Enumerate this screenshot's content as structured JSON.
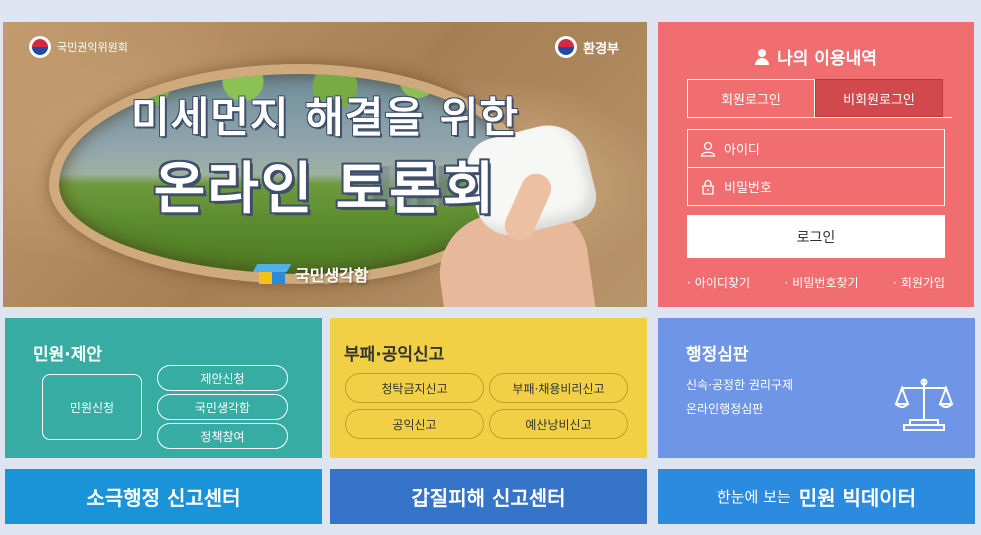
{
  "banner": {
    "org_left": "국민권익위원회",
    "org_right": "환경부",
    "title_line1": "미세먼지 해결을 위한",
    "title_line2": "온라인 토론회",
    "brand": "국민생각함"
  },
  "login": {
    "heading": "나의 이용내역",
    "tab_member": "회원로그인",
    "tab_guest": "비회원로그인",
    "id_placeholder": "아이디",
    "pw_placeholder": "비밀번호",
    "login_button": "로그인",
    "links": [
      "아이디찾기",
      "비밀번호찾기",
      "회원가입"
    ]
  },
  "petition": {
    "title": "민원·제안",
    "main_button": "민원신청",
    "buttons": [
      "제안신청",
      "국민생각함",
      "정책참여"
    ]
  },
  "report": {
    "title": "부패·공익신고",
    "buttons": [
      "청탁금지신고",
      "부패·채용비리신고",
      "공익신고",
      "예산낭비신고"
    ]
  },
  "trial": {
    "title": "행정심판",
    "desc1": "신속·공정한 권리구제",
    "desc2": "온라인행정심판"
  },
  "bars": {
    "passive_admin": "소극행정 신고센터",
    "gapjil": "갑질피해 신고센터",
    "bigdata_prefix": "한눈에 보는",
    "bigdata": "민원 빅데이터"
  },
  "colors": {
    "login_bg": "#f06e70",
    "teal": "#37aca2",
    "yellow": "#f1d045",
    "blue": "#6e95e6"
  }
}
